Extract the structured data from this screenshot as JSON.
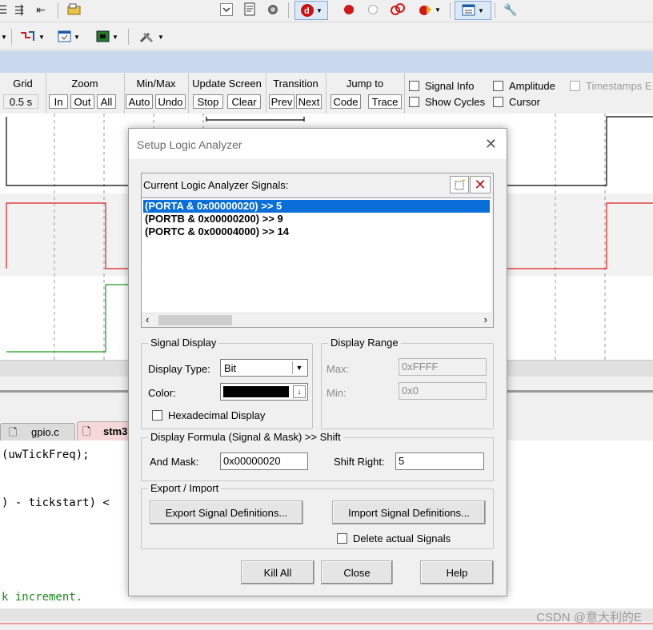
{
  "toolbar_row1": {
    "items": [
      "format-icon",
      "indent-icon",
      "unindent-icon",
      "open-folder-icon",
      "dropdown-icon",
      "bookmark-icon",
      "flash-icon",
      "debug-icon",
      "breakpoint-icon",
      "empty-breakpoint-icon",
      "disable-breakpoint-icon",
      "kill-breakpoints-icon",
      "window-icon",
      "wrench-icon"
    ]
  },
  "toolbar_row2": {
    "items": [
      "config-icon",
      "run-icon",
      "view-icon",
      "board-icon",
      "tools-icon"
    ]
  },
  "analyzer": {
    "groups": [
      {
        "title": "Grid",
        "buttons": [
          "0.5 s"
        ]
      },
      {
        "title": "Zoom",
        "buttons": [
          "In",
          "Out",
          "All"
        ]
      },
      {
        "title": "Min/Max",
        "buttons": [
          "Auto",
          "Undo"
        ]
      },
      {
        "title": "Update Screen",
        "buttons": [
          "Stop",
          "Clear"
        ]
      },
      {
        "title": "Transition",
        "buttons": [
          "Prev",
          "Next"
        ]
      },
      {
        "title": "Jump to",
        "buttons": [
          "Code",
          "Trace"
        ]
      }
    ],
    "checks": {
      "signal_info": "Signal Info",
      "show_cycles": "Show Cycles",
      "amplitude": "Amplitude",
      "cursor": "Cursor",
      "timestamps": "Timestamps E"
    },
    "colors": {
      "signal1": "#000000",
      "signal2": "#e02020",
      "signal3": "#1a9a1a"
    }
  },
  "editor": {
    "tabs": [
      "gpio.c",
      "stm3"
    ],
    "lines": [
      "(uwTickFreq);",
      ") - tickstart) <",
      "k increment."
    ]
  },
  "dialog": {
    "title": "Setup Logic Analyzer",
    "signals_label": "Current Logic Analyzer Signals:",
    "signals": [
      "(PORTA & 0x00000020) >> 5",
      "(PORTB & 0x00000200) >> 9",
      "(PORTC & 0x00004000) >> 14"
    ],
    "signal_display": {
      "legend": "Signal Display",
      "type_label": "Display Type:",
      "type_value": "Bit",
      "color_label": "Color:",
      "color_value": "#000000",
      "hex_label": "Hexadecimal Display"
    },
    "display_range": {
      "legend": "Display Range",
      "max_label": "Max:",
      "max_value": "0xFFFF",
      "min_label": "Min:",
      "min_value": "0x0"
    },
    "formula": {
      "legend": "Display Formula (Signal & Mask) >> Shift",
      "mask_label": "And Mask:",
      "mask_value": "0x00000020",
      "shift_label": "Shift Right:",
      "shift_value": "5"
    },
    "export_import": {
      "legend": "Export / Import",
      "export_label": "Export Signal Definitions...",
      "import_label": "Import Signal Definitions...",
      "delete_label": "Delete actual Signals"
    },
    "buttons": {
      "kill_all": "Kill All",
      "close": "Close",
      "help": "Help"
    }
  },
  "watermark": "CSDN @意大利的E"
}
